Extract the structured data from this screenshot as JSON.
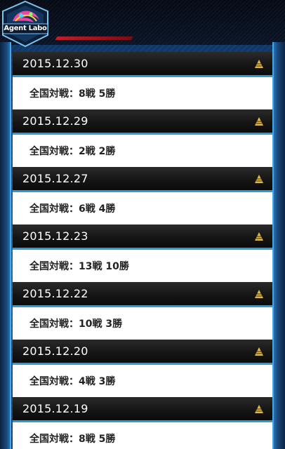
{
  "app": {
    "logo_text": "Agent Labo"
  },
  "entries": [
    {
      "date": "2015.12.30",
      "record": "全国対戦：8戦 5勝"
    },
    {
      "date": "2015.12.29",
      "record": "全国対戦：2戦 2勝"
    },
    {
      "date": "2015.12.27",
      "record": "全国対戦：6戦 4勝"
    },
    {
      "date": "2015.12.23",
      "record": "全国対戦：13戦 10勝"
    },
    {
      "date": "2015.12.22",
      "record": "全国対戦：10戦 3勝"
    },
    {
      "date": "2015.12.20",
      "record": "全国対戦：4戦 3勝"
    },
    {
      "date": "2015.12.19",
      "record": "全国対戦：8戦 5勝"
    }
  ],
  "icons": {
    "collapse": "collapse-triangle-icon",
    "logo": "agent-labo-emblem"
  },
  "colors": {
    "accent": "#2e9ad6",
    "gold": "#e0b84a",
    "header_red": "#c0202a"
  }
}
